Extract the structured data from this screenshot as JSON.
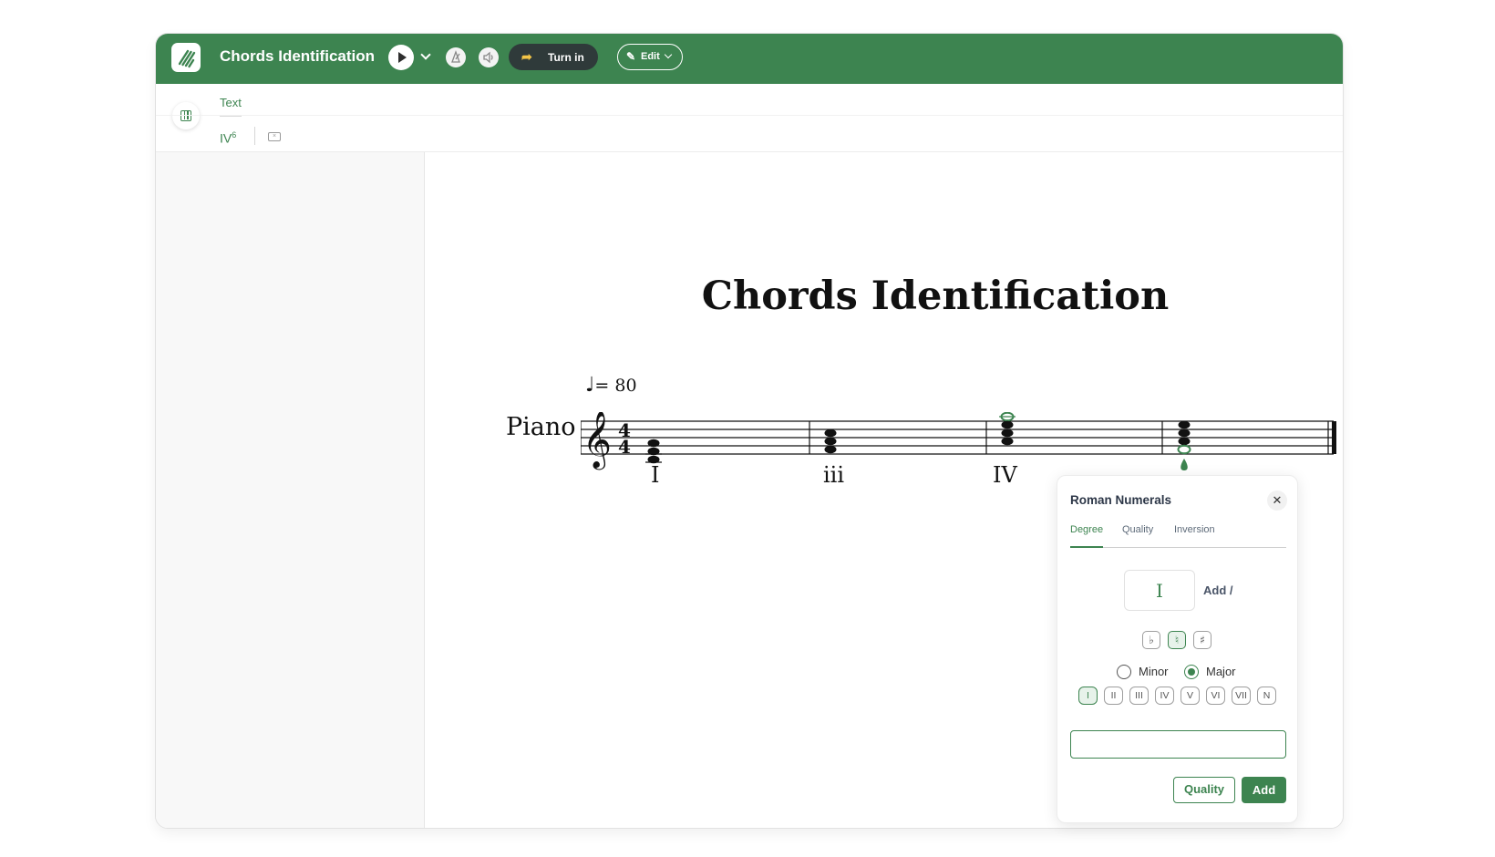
{
  "header": {
    "title": "Chords Identification",
    "turn_in_label": "Turn in",
    "edit_label": "Edit"
  },
  "toolbar": {
    "tab_label": "Text",
    "chip_base": "IV",
    "chip_sup": "6"
  },
  "score": {
    "title": "Chords Identification",
    "tempo_value": "= 80",
    "instrument": "Piano",
    "time_signature": "4/4",
    "roman_numerals": [
      "I",
      "iii",
      "IV"
    ]
  },
  "popup": {
    "title": "Roman Numerals",
    "close_glyph": "✕",
    "tabs": [
      "Degree",
      "Quality",
      "Inversion"
    ],
    "active_tab": "Degree",
    "degree_value": "I",
    "add_slash_label": "Add /",
    "accidentals": [
      "♭",
      "♮",
      "♯"
    ],
    "selected_accidental": "♮",
    "mode_options": [
      "Minor",
      "Major"
    ],
    "selected_mode": "Major",
    "degrees": [
      "I",
      "II",
      "III",
      "IV",
      "V",
      "VI",
      "VII",
      "N"
    ],
    "selected_degree": "I",
    "input_value": "",
    "quality_button": "Quality",
    "add_button": "Add"
  },
  "colors": {
    "brand_green": "#3d8450",
    "dark_button": "#2f3a3a"
  }
}
